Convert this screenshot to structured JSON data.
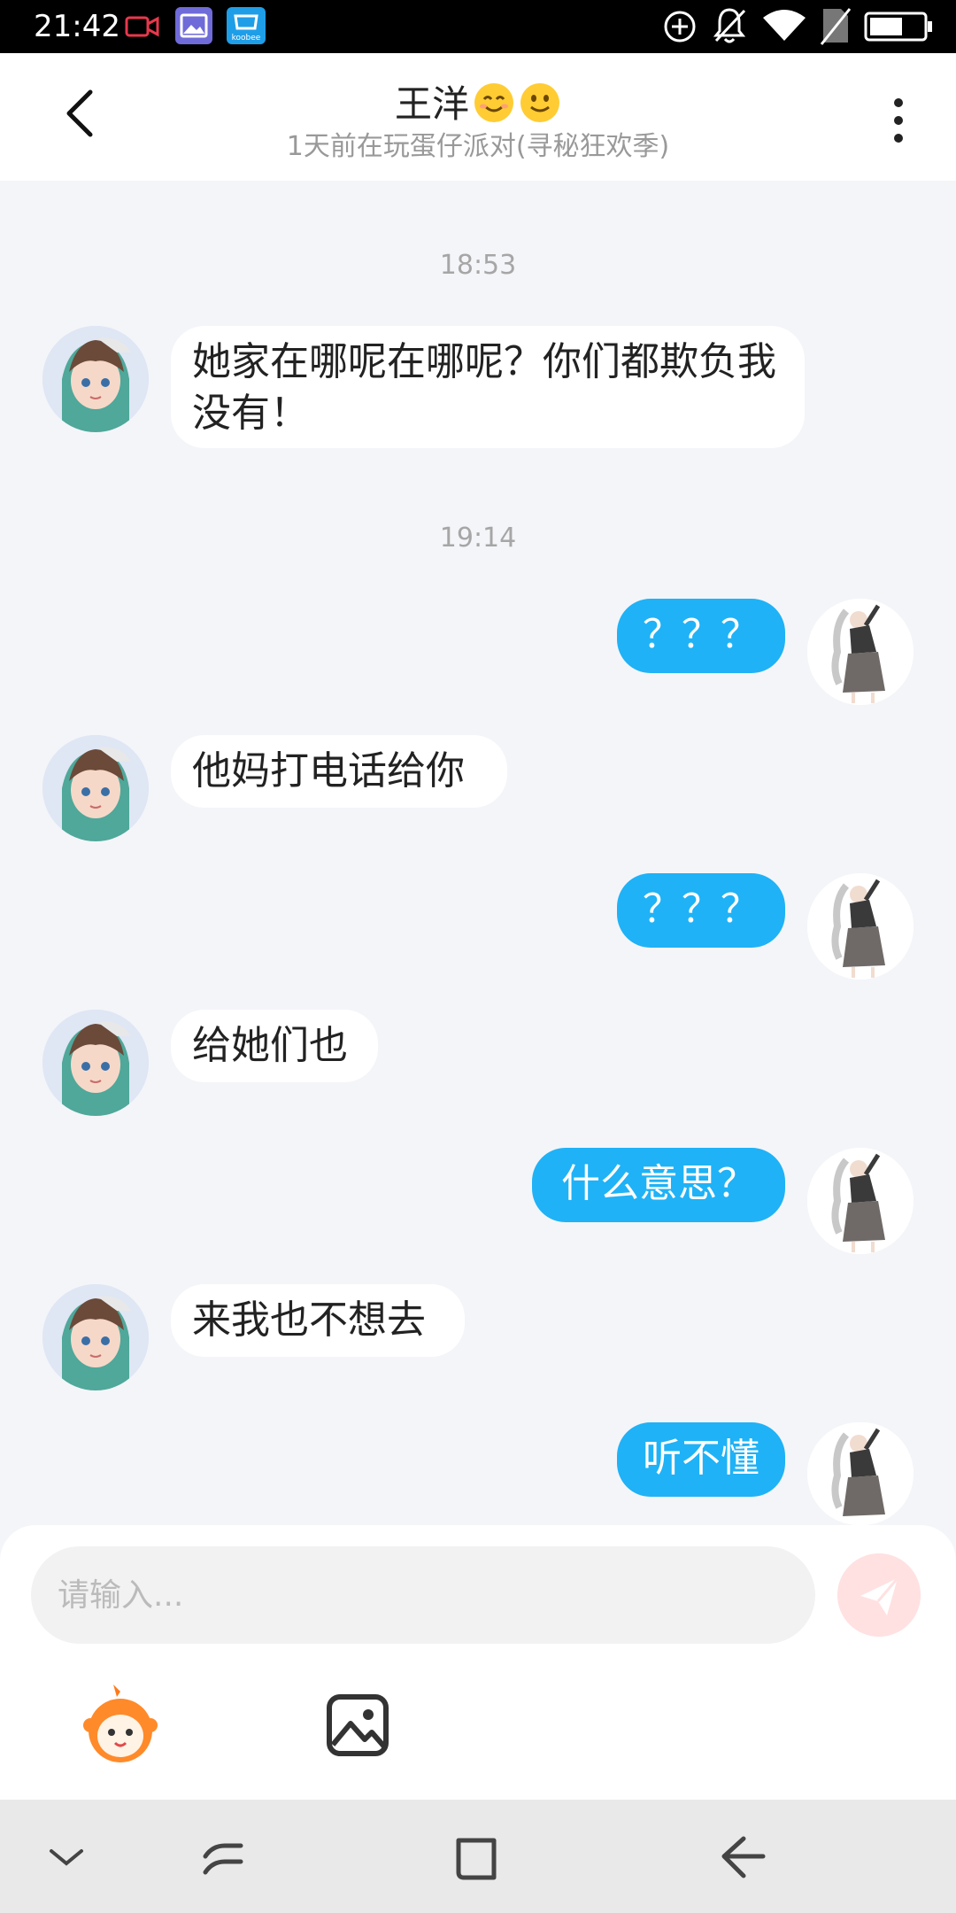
{
  "status_bar": {
    "time": "21:42",
    "icons": [
      "screen-record-icon",
      "gallery-app-icon",
      "koobee-store-icon",
      "add-circle-icon",
      "bell-off-icon",
      "wifi-icon",
      "no-sim-icon",
      "battery-icon"
    ],
    "store_label": "koobee"
  },
  "header": {
    "title": "王洋",
    "subtitle": "1天前在玩蛋仔派对(寻秘狂欢季)",
    "emoji": [
      "smiling-face-emoji",
      "slightly-smiling-face-emoji"
    ]
  },
  "messages": [
    {
      "timestamp": "18:53"
    },
    {
      "side": "left",
      "text": "她家在哪呢在哪呢？你们都欺负我没有！"
    },
    {
      "timestamp": "19:14"
    },
    {
      "side": "right",
      "text": "？？？"
    },
    {
      "side": "left",
      "text": "他妈打电话给你"
    },
    {
      "side": "right",
      "text": "？？？"
    },
    {
      "side": "left",
      "text": "给她们也"
    },
    {
      "side": "right",
      "text": "什么意思？"
    },
    {
      "side": "left",
      "text": "来我也不想去"
    },
    {
      "side": "right",
      "text": "听不懂"
    }
  ],
  "composer": {
    "placeholder": "请输入...",
    "tools": [
      "sticker-mascot-icon",
      "image-picker-icon"
    ],
    "send_icon": "send-icon"
  },
  "nav_bar": {
    "buttons": [
      "collapse-icon",
      "recents-icon",
      "home-icon",
      "back-icon"
    ]
  },
  "colors": {
    "accent": "#1fb2f6",
    "background": "#f4f5f9",
    "send_disabled": "#ffe1e1"
  }
}
